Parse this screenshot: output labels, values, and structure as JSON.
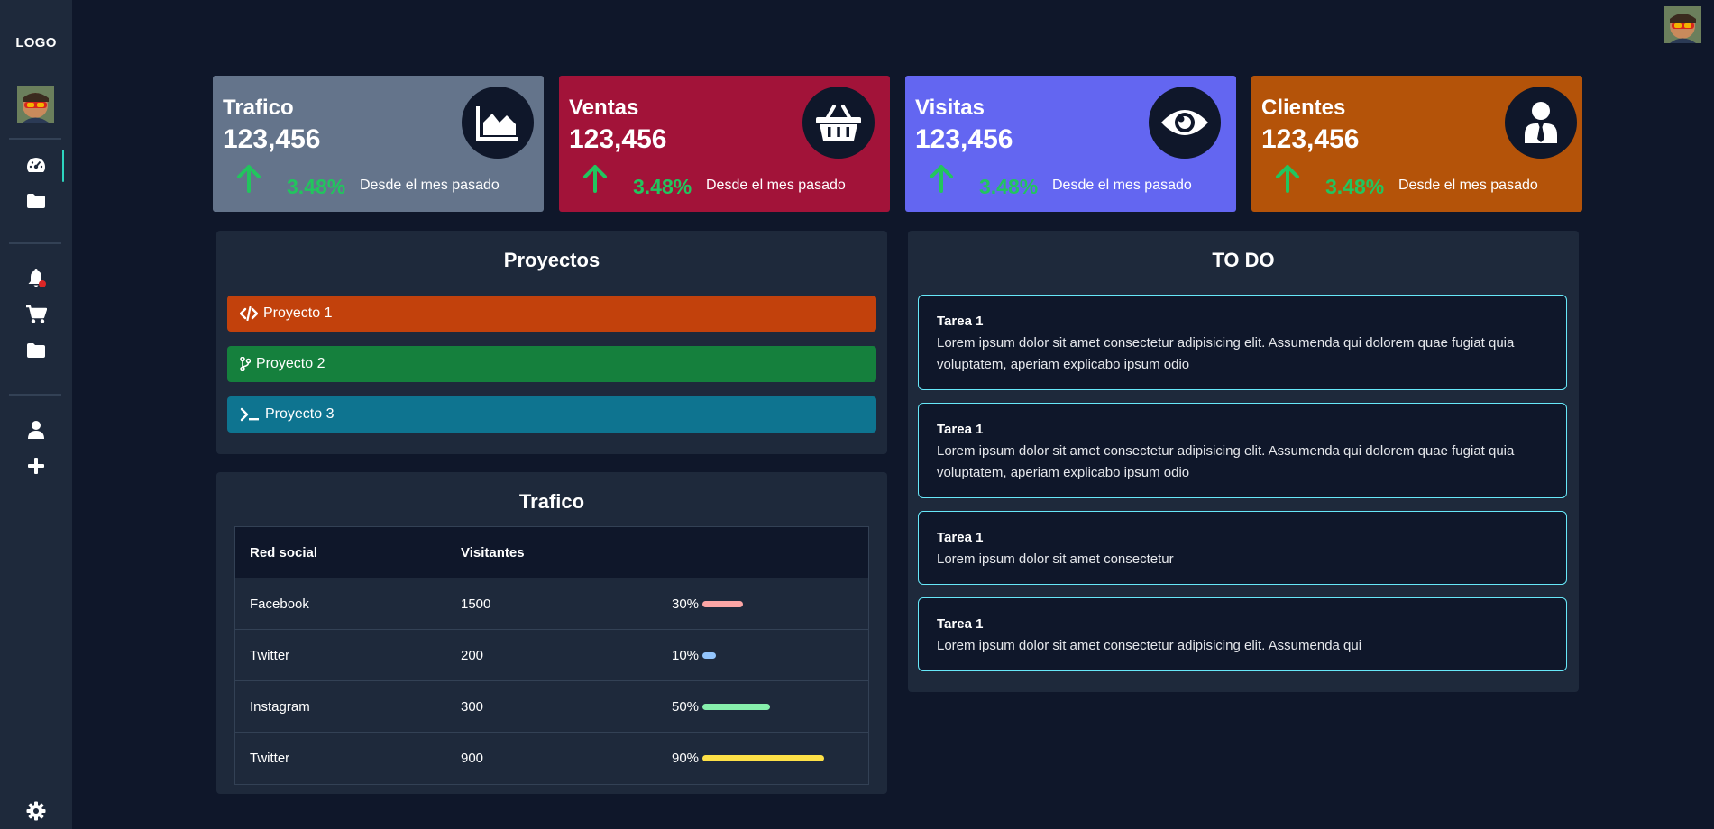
{
  "sidebar": {
    "logo": "LOGO"
  },
  "stats": [
    {
      "title": "Trafico",
      "value": "123,456",
      "pct": "3.48%",
      "note": "Desde el mes pasado",
      "color": "#64748b",
      "icon": "area-chart-icon"
    },
    {
      "title": "Ventas",
      "value": "123,456",
      "pct": "3.48%",
      "note": "Desde el mes pasado",
      "color": "#a21339",
      "icon": "basket-icon"
    },
    {
      "title": "Visitas",
      "value": "123,456",
      "pct": "3.48%",
      "note": "Desde el mes pasado",
      "color": "#6366f1",
      "icon": "eye-icon"
    },
    {
      "title": "Clientes",
      "value": "123,456",
      "pct": "3.48%",
      "note": "Desde el mes pasado",
      "color": "#b45309",
      "icon": "user-tie-icon"
    }
  ],
  "projects": {
    "title": "Proyectos",
    "items": [
      {
        "label": "Proyecto 1",
        "color": "#c2410c",
        "icon": "code-icon"
      },
      {
        "label": "Proyecto 2",
        "color": "#15803d",
        "icon": "git-branch-icon"
      },
      {
        "label": "Proyecto 3",
        "color": "#0e7490",
        "icon": "terminal-icon"
      }
    ]
  },
  "traffic": {
    "title": "Trafico",
    "headers": [
      "Red social",
      "Visitantes"
    ],
    "rows": [
      {
        "network": "Facebook",
        "visitors": "1500",
        "pct_label": "30%",
        "pct": 30,
        "color": "#fca5a5"
      },
      {
        "network": "Twitter",
        "visitors": "200",
        "pct_label": "10%",
        "pct": 10,
        "color": "#93c5fd"
      },
      {
        "network": "Instagram",
        "visitors": "300",
        "pct_label": "50%",
        "pct": 50,
        "color": "#86efac"
      },
      {
        "network": "Twitter",
        "visitors": "900",
        "pct_label": "90%",
        "pct": 90,
        "color": "#fde047"
      }
    ]
  },
  "todo": {
    "title": "TO DO",
    "items": [
      {
        "title": "Tarea 1",
        "text": "Lorem ipsum dolor sit amet consectetur adipisicing elit. Assumenda qui dolorem quae fugiat quia voluptatem, aperiam explicabo ipsum odio"
      },
      {
        "title": "Tarea 1",
        "text": "Lorem ipsum dolor sit amet consectetur adipisicing elit. Assumenda qui dolorem quae fugiat quia voluptatem, aperiam explicabo ipsum odio"
      },
      {
        "title": "Tarea 1",
        "text": "Lorem ipsum dolor sit amet consectetur"
      },
      {
        "title": "Tarea 1",
        "text": "Lorem ipsum dolor sit amet consectetur adipisicing elit. Assumenda qui"
      }
    ]
  }
}
